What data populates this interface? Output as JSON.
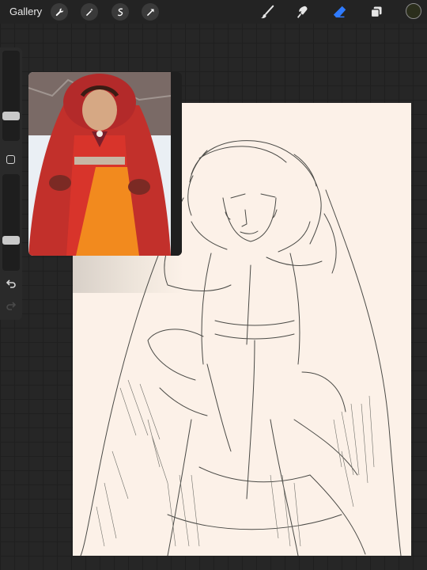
{
  "topbar": {
    "gallery_label": "Gallery",
    "left_tools": [
      "wrench-icon",
      "magic-wand-icon",
      "selection-icon",
      "transform-icon"
    ],
    "right_tools": [
      "brush-icon",
      "smudge-icon",
      "eraser-icon",
      "layers-icon"
    ],
    "active_tool": "eraser-icon",
    "accent_color": "#2f7bff",
    "current_color": "#2b2e1c"
  },
  "sidebar": {
    "brush_size_level": 0.25,
    "opacity_level": 0.3
  },
  "canvas": {
    "background_color": "#fcf1e8",
    "sketch_color": "#3f3f3c"
  }
}
